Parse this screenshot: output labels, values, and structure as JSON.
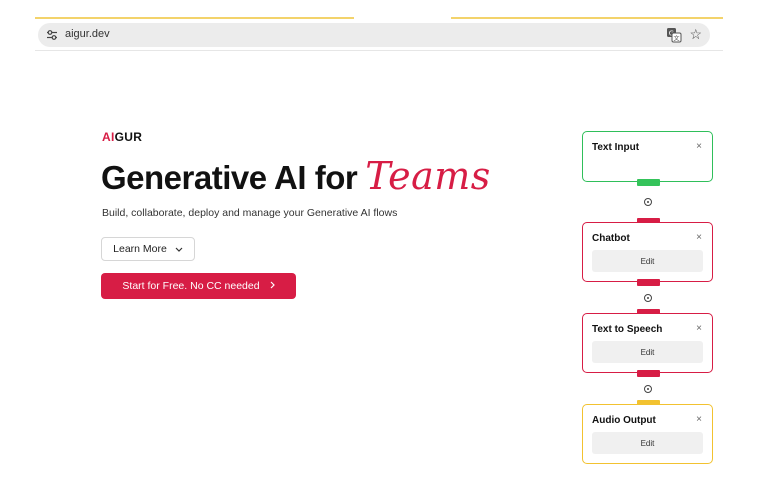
{
  "browser": {
    "url": "aigur.dev",
    "icons": {
      "site_settings": "tune-icon",
      "translate": "translate-icon",
      "bookmark": "star-icon"
    }
  },
  "hero": {
    "brand_accent": "AI",
    "brand_rest": "GUR",
    "headline_main": "Generative AI for",
    "headline_script": "Teams",
    "subtitle": "Build, collaborate, deploy and manage your Generative AI flows",
    "learn_more_label": "Learn More",
    "cta_label": "Start for Free. No CC needed"
  },
  "flow": {
    "nodes": [
      {
        "title": "Text Input",
        "edit_label": ""
      },
      {
        "title": "Chatbot",
        "edit_label": "Edit"
      },
      {
        "title": "Text to Speech",
        "edit_label": "Edit"
      },
      {
        "title": "Audio Output",
        "edit_label": "Edit"
      }
    ],
    "close_symbol": "×"
  },
  "colors": {
    "brand_red": "#d71d45",
    "input_green": "#2fbf5a",
    "output_yellow": "#f2c230"
  }
}
